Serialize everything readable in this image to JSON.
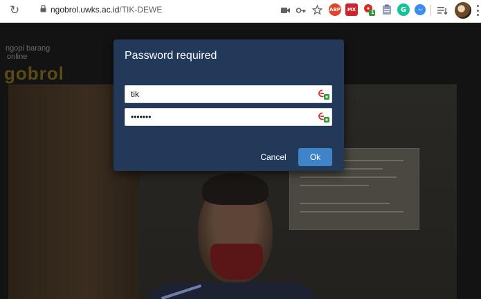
{
  "browser": {
    "url_host": "ngobrol.uwks.ac.id",
    "url_path": "/TIK-DEWE",
    "extensions": [
      {
        "icon": "camera-icon"
      },
      {
        "icon": "key-icon"
      },
      {
        "icon": "star-icon"
      },
      {
        "icon": "adblock-icon",
        "label": "ABP",
        "color": "#e0452a"
      },
      {
        "icon": "mx-extension-icon",
        "label": "MX",
        "color": "#d3222a"
      },
      {
        "icon": "lastpass-icon",
        "badge": "1",
        "color": "#d32d27"
      },
      {
        "icon": "clipboard-icon",
        "color": "#8a8fa6"
      },
      {
        "icon": "grammarly-icon",
        "label": "G",
        "color": "#15c39a"
      },
      {
        "icon": "messenger-icon",
        "color": "#3b8bf0"
      },
      {
        "icon": "reading-list-icon"
      }
    ]
  },
  "background": {
    "logo_line1": "ngopi  barang",
    "logo_line2": "online",
    "logo_main": "gobrol"
  },
  "dialog": {
    "title": "Password required",
    "username_value": "tik",
    "password_value": "•••••••",
    "cancel_label": "Cancel",
    "ok_label": "Ok"
  },
  "colors": {
    "dialog_bg": "#22395a",
    "ok_button": "#3f83c9",
    "page_bg": "#131313"
  }
}
